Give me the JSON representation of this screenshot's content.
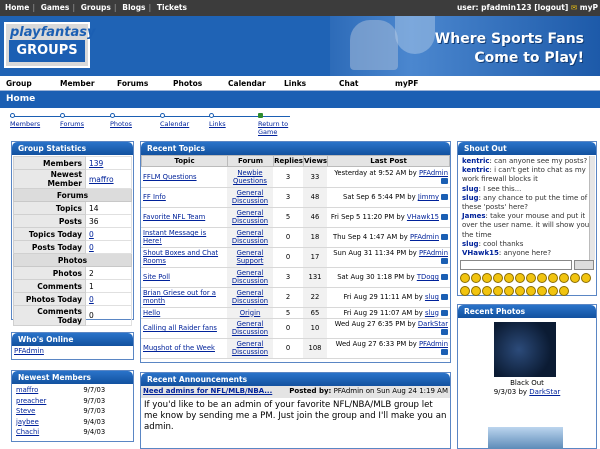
{
  "topbar": {
    "nav": [
      "Home",
      "Games",
      "Groups",
      "Blogs",
      "Tickets"
    ],
    "user_prefix": "user: pfadmin123 [logout]",
    "myp": "myP"
  },
  "banner": {
    "logo_top": "playfantasy",
    "logo_bottom": "GROUPS",
    "tagline_1": "Where Sports Fans",
    "tagline_2": "Come to Play!"
  },
  "menu": [
    "Group",
    "Member",
    "Forums",
    "Photos",
    "Calendar",
    "Links",
    "Chat",
    "myPF"
  ],
  "homebar": {
    "title": "Home"
  },
  "subnav": [
    "Members",
    "Forums",
    "Photos",
    "Calendar",
    "Links",
    "Return to Game"
  ],
  "group_stats": {
    "title": "Group Statistics",
    "members_label": "Members",
    "members_value": "139",
    "newest_label": "Newest Member",
    "newest_value": "maffro",
    "forums_header": "Forums",
    "topics_label": "Topics",
    "topics_value": "14",
    "posts_label": "Posts",
    "posts_value": "36",
    "topics_today_label": "Topics Today",
    "topics_today_value": "0",
    "posts_today_label": "Posts Today",
    "posts_today_value": "0",
    "photos_header": "Photos",
    "photos_label": "Photos",
    "photos_value": "2",
    "comments_label": "Comments",
    "comments_value": "1",
    "photos_today_label": "Photos Today",
    "photos_today_value": "0",
    "comments_today_label": "Comments Today",
    "comments_today_value": "0"
  },
  "whos_online": {
    "title": "Who's Online",
    "user": "PFAdmin"
  },
  "newest_members": {
    "title": "Newest Members",
    "rows": [
      {
        "name": "maffro",
        "date": "9/7/03"
      },
      {
        "name": "preacher",
        "date": "9/7/03"
      },
      {
        "name": "Steve",
        "date": "9/7/03"
      },
      {
        "name": "jaybee",
        "date": "9/4/03"
      },
      {
        "name": "Chachi",
        "date": "9/4/03"
      }
    ]
  },
  "recent_topics": {
    "title": "Recent Topics",
    "headers": [
      "Topic",
      "Forum",
      "Replies",
      "Views",
      "Last Post"
    ],
    "rows": [
      {
        "topic": "FFLM Questions",
        "forum": "Newbie Questions",
        "replies": "3",
        "views": "33",
        "last": "Yesterday at 9:52 AM by",
        "by": "PFAdmin"
      },
      {
        "topic": "FF Info",
        "forum": "General Discussion",
        "replies": "3",
        "views": "48",
        "last": "Sat Sep 6 5:44 PM by",
        "by": "Jimmy"
      },
      {
        "topic": "Favorite NFL Team",
        "forum": "General Discussion",
        "replies": "5",
        "views": "46",
        "last": "Fri Sep 5 11:20 PM by",
        "by": "VHawk15"
      },
      {
        "topic": "Instant Message is Here!",
        "forum": "General Discussion",
        "replies": "0",
        "views": "18",
        "last": "Thu Sep 4 1:47 AM by",
        "by": "PFAdmin"
      },
      {
        "topic": "Shout Boxes and Chat Rooms",
        "forum": "General Support",
        "replies": "0",
        "views": "17",
        "last": "Sun Aug 31 11:34 PM by",
        "by": "PFAdmin"
      },
      {
        "topic": "Site Poll",
        "forum": "General Discussion",
        "replies": "3",
        "views": "131",
        "last": "Sat Aug 30 1:18 PM by",
        "by": "TDogg"
      },
      {
        "topic": "Brian Griese out for a month",
        "forum": "General Discussion",
        "replies": "2",
        "views": "22",
        "last": "Fri Aug 29 11:11 AM by",
        "by": "slug"
      },
      {
        "topic": "Hello",
        "forum": "Origin",
        "replies": "5",
        "views": "65",
        "last": "Fri Aug 29 11:07 AM by",
        "by": "slug"
      },
      {
        "topic": "Calling all Raider fans",
        "forum": "General Discussion",
        "replies": "0",
        "views": "10",
        "last": "Wed Aug 27 6:35 PM by",
        "by": "DarkStar"
      },
      {
        "topic": "Mugshot of the Week",
        "forum": "General Discussion",
        "replies": "0",
        "views": "108",
        "last": "Wed Aug 27 6:33 PM by",
        "by": "PFAdmin"
      }
    ]
  },
  "recent_announcements": {
    "title": "Recent Announcements",
    "subject": "Need admins for NFL/MLB/NBA...",
    "posted_label": "Posted by:",
    "posted_by": "PFAdmin on Sun Aug 24 1:19 AM",
    "body": "If you'd like to be an admin of your favorite NFL/NBA/MLB group let me know by sending me a PM. Just join the group and I'll make you an admin."
  },
  "shout_out": {
    "title": "Shout Out",
    "messages": [
      {
        "user": "kentric",
        "text": "can anyone see my posts?"
      },
      {
        "user": "kentric",
        "text": "i can't get into chat as my work firewall blocks it"
      },
      {
        "user": "slug",
        "text": "I see this..."
      },
      {
        "user": "slug",
        "text": "any chance to put the time of these 'posts' here?"
      },
      {
        "user": "James",
        "text": "take your mouse and put it over the user name. it will show you the time"
      },
      {
        "user": "slug",
        "text": "cool thanks"
      },
      {
        "user": "VHawk15",
        "text": "anyone here?"
      }
    ]
  },
  "recent_photos": {
    "title": "Recent Photos",
    "caption": "Black Out",
    "date_by": "9/3/03 by",
    "author": "DarkStar"
  }
}
